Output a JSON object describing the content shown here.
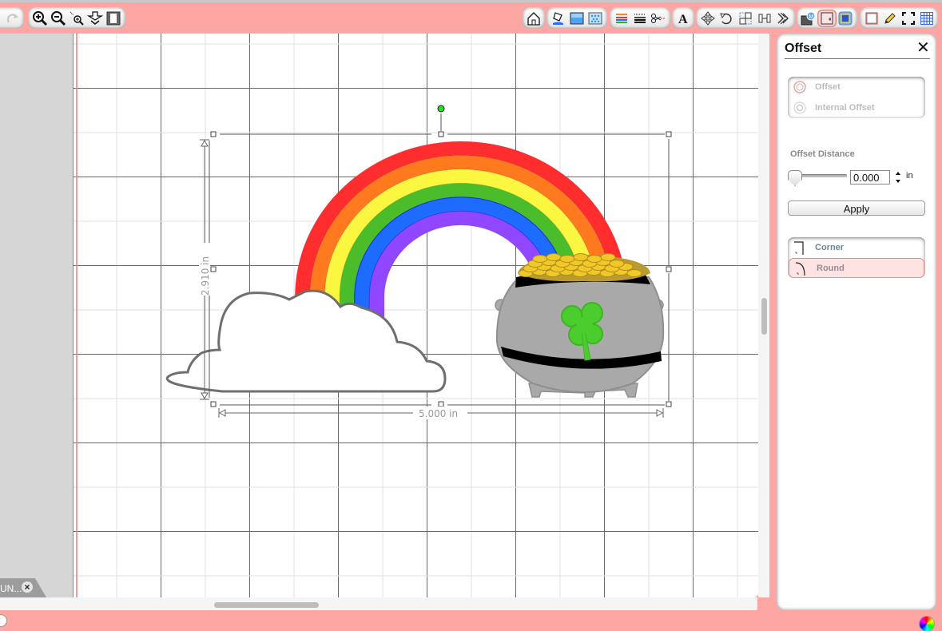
{
  "toolbar": {
    "groups": [
      {
        "name": "history",
        "buttons": [
          {
            "id": "redo",
            "icon": "redo-icon",
            "label": "Redo"
          }
        ]
      },
      {
        "name": "zoom",
        "buttons": [
          {
            "id": "zoom-in",
            "icon": "zoom-in-icon",
            "label": "Zoom In"
          },
          {
            "id": "zoom-out",
            "icon": "zoom-out-icon",
            "label": "Zoom Out"
          },
          {
            "id": "zoom-selection",
            "icon": "zoom-selection-icon",
            "label": "Zoom to Selection"
          },
          {
            "id": "zoom-fit",
            "icon": "fit-icon",
            "label": "Fit"
          },
          {
            "id": "fit-page",
            "icon": "page-icon",
            "label": "Fit Page"
          }
        ]
      },
      {
        "name": "home",
        "buttons": [
          {
            "id": "home",
            "icon": "home-icon",
            "label": "Design Page"
          }
        ]
      },
      {
        "name": "fill",
        "buttons": [
          {
            "id": "fill",
            "icon": "paint-bucket-icon",
            "label": "Fill"
          },
          {
            "id": "fill-color",
            "icon": "fill-color-icon",
            "label": "Fill Color"
          },
          {
            "id": "fill-pattern",
            "icon": "fill-pattern-icon",
            "label": "Fill Pattern"
          }
        ]
      },
      {
        "name": "lines",
        "buttons": [
          {
            "id": "line-color",
            "icon": "line-color-icon",
            "label": "Line Color"
          },
          {
            "id": "line-style",
            "icon": "line-style-icon",
            "label": "Line Style"
          },
          {
            "id": "cut-style",
            "icon": "scissors-icon",
            "label": "Cut Settings"
          }
        ]
      },
      {
        "name": "text",
        "buttons": [
          {
            "id": "text",
            "icon": "text-icon",
            "label": "Text"
          }
        ]
      },
      {
        "name": "transform",
        "buttons": [
          {
            "id": "move",
            "icon": "move-icon",
            "label": "Move"
          },
          {
            "id": "rotate",
            "icon": "rotate-icon",
            "label": "Rotate"
          },
          {
            "id": "scale",
            "icon": "scale-icon",
            "label": "Scale"
          },
          {
            "id": "align",
            "icon": "align-icon",
            "label": "Align"
          },
          {
            "id": "replicate",
            "icon": "replicate-icon",
            "label": "Replicate"
          }
        ]
      },
      {
        "name": "modify",
        "buttons": [
          {
            "id": "modify",
            "icon": "modify-icon",
            "label": "Modify"
          },
          {
            "id": "offset",
            "icon": "offset-icon",
            "label": "Offset",
            "active": true
          },
          {
            "id": "trace",
            "icon": "trace-icon",
            "label": "Trace"
          }
        ]
      },
      {
        "name": "misc",
        "buttons": [
          {
            "id": "page-setup",
            "icon": "page-setup-icon",
            "label": "Page Setup"
          },
          {
            "id": "draw",
            "icon": "pencil-icon",
            "label": "Draw"
          },
          {
            "id": "fullscreen",
            "icon": "fullscreen-icon",
            "label": "Full Screen"
          },
          {
            "id": "grid",
            "icon": "grid-icon",
            "label": "Grid"
          }
        ]
      }
    ]
  },
  "document_tab": {
    "label": "UN...",
    "close_icon": "close-icon"
  },
  "canvas": {
    "selection": {
      "width_label": "5.000 in",
      "height_label": "2.910 in"
    },
    "artwork": [
      {
        "name": "rainbow",
        "bands": [
          "#ff2d2d",
          "#ff7a1e",
          "#fbf740",
          "#4cbd2a",
          "#1e6bff",
          "#9147ff"
        ]
      },
      {
        "name": "cloud",
        "fill": "#ffffff",
        "stroke": "#6f6f6f"
      },
      {
        "name": "pot-of-gold",
        "body": "#a9a9a9",
        "band": "#000000",
        "coins": "#f0c928",
        "shamrock": "#4ccd2e"
      }
    ],
    "rotate_handle_color": "#22dd22"
  },
  "panel": {
    "title": "Offset",
    "mode_options": [
      {
        "label": "Offset",
        "icon": "offset-ring-icon",
        "enabled": false
      },
      {
        "label": "Internal Offset",
        "icon": "internal-offset-icon",
        "enabled": false
      }
    ],
    "distance_label": "Offset Distance",
    "distance_value": "0.000",
    "distance_slider_fraction": 0,
    "distance_unit": "in",
    "apply_label": "Apply",
    "corner_options": [
      {
        "label": "Corner",
        "icon": "corner-icon",
        "selected": false
      },
      {
        "label": "Round",
        "icon": "round-corner-icon",
        "selected": true
      }
    ]
  },
  "colors": {
    "chrome": "#fea6a3",
    "accent_selected": "#fde3e3"
  }
}
